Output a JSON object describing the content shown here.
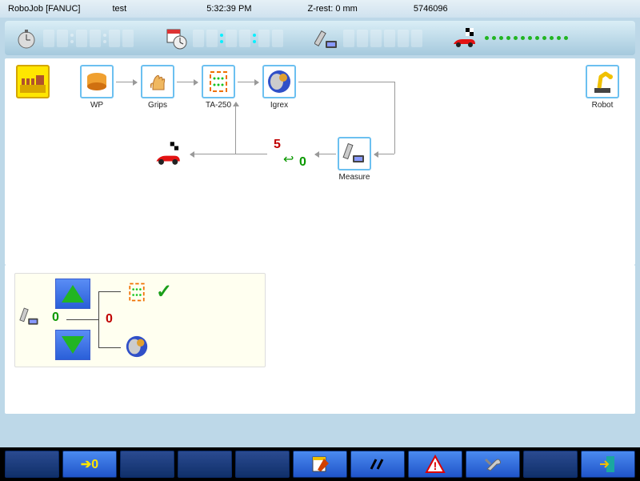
{
  "titlebar": {
    "app": "RoboJob [FANUC]",
    "program": "test",
    "time": "5:32:39 PM",
    "zrest": "Z-rest: 0 mm",
    "counter": "5746096"
  },
  "flow": {
    "nodes": {
      "wp": "WP",
      "grips": "Grips",
      "ta250": "TA-250",
      "igrex": "Igrex",
      "robot": "Robot",
      "measure": "Measure"
    },
    "reject_count": "5",
    "accept_count": "0"
  },
  "accept_panel": {
    "value": "0",
    "reject_value": "0"
  },
  "toolbar": {
    "reset": "➔0"
  }
}
